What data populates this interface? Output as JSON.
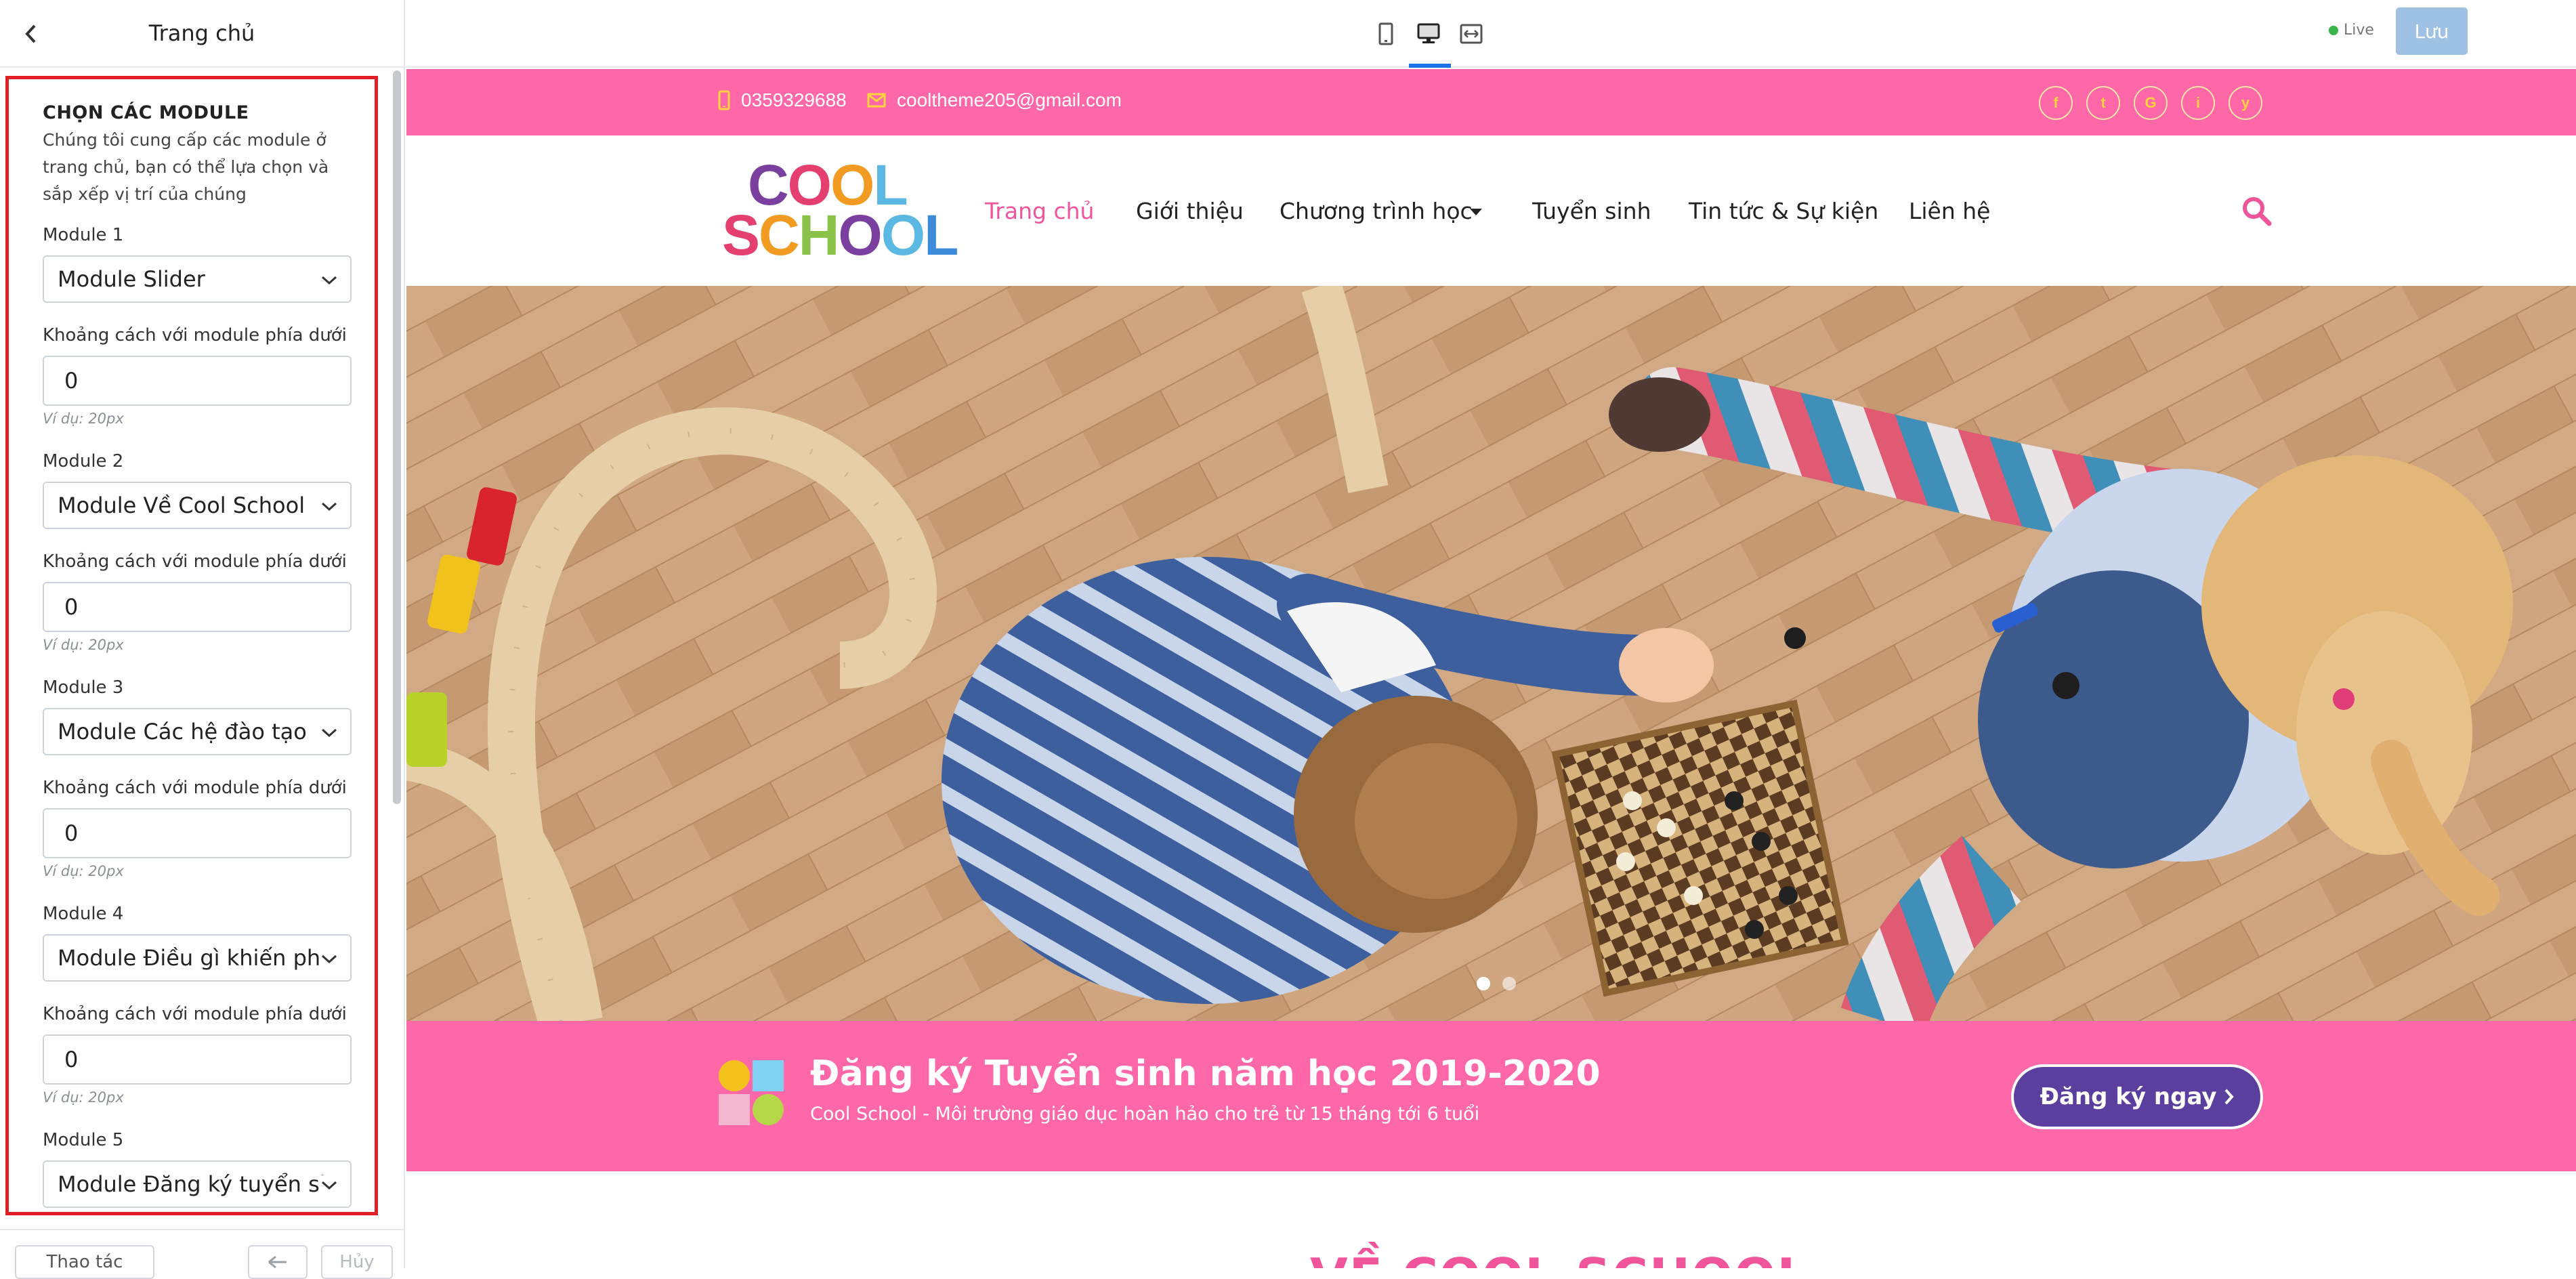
{
  "panel": {
    "title": "Trang chủ",
    "section_title": "CHỌN CÁC MODULE",
    "section_desc": "Chúng tôi cung cấp các module ở trang chủ, bạn có thể lựa chọn và sắp xếp vị trí của chúng",
    "modules": [
      {
        "label": "Module 1",
        "value": "Module Slider",
        "spacing_label": "Khoảng cách với module phía dưới",
        "spacing_value": "0",
        "hint": "Ví dụ: 20px"
      },
      {
        "label": "Module 2",
        "value": "Module Về Cool School",
        "spacing_label": "Khoảng cách với module phía dưới",
        "spacing_value": "0",
        "hint": "Ví dụ: 20px"
      },
      {
        "label": "Module 3",
        "value": "Module Các hệ đào tạo",
        "spacing_label": "Khoảng cách với module phía dưới",
        "spacing_value": "0",
        "hint": "Ví dụ: 20px"
      },
      {
        "label": "Module 4",
        "value": "Module Điều gì khiến phụ",
        "spacing_label": "Khoảng cách với module phía dưới",
        "spacing_value": "0",
        "hint": "Ví dụ: 20px"
      },
      {
        "label": "Module 5",
        "value": "Module Đăng ký tuyển sin"
      }
    ],
    "footer": {
      "actions_label": "Thao tác",
      "undo_label": "",
      "redo_label": "Hủy"
    }
  },
  "toolbar": {
    "live_label": "Live",
    "save_label": "Lưu"
  },
  "site": {
    "phone": "0359329688",
    "email": "cooltheme205@gmail.com",
    "social": [
      "f",
      "t",
      "G",
      "i",
      "y"
    ],
    "logo_top": "COOL",
    "logo_bottom": "SCHOOL",
    "nav": [
      "Trang chủ",
      "Giới thiệu",
      "Chương trình học",
      "Tuyển sinh",
      "Tin tức & Sự kiện",
      "Liên hệ"
    ],
    "banner_title": "Đăng ký Tuyển sinh năm học 2019-2020",
    "banner_sub": "Cool School - Môi trường giáo dục hoàn hảo cho trẻ từ 15 tháng tới 6 tuổi",
    "cta_label": "Đăng ký ngay",
    "next_section_title": "VỀ COOL SCHOOL"
  },
  "colors": {
    "accent": "#fe68a8",
    "cta": "#5a3f9f",
    "save": "#9fc1e3",
    "highlight": "#e01f26"
  }
}
